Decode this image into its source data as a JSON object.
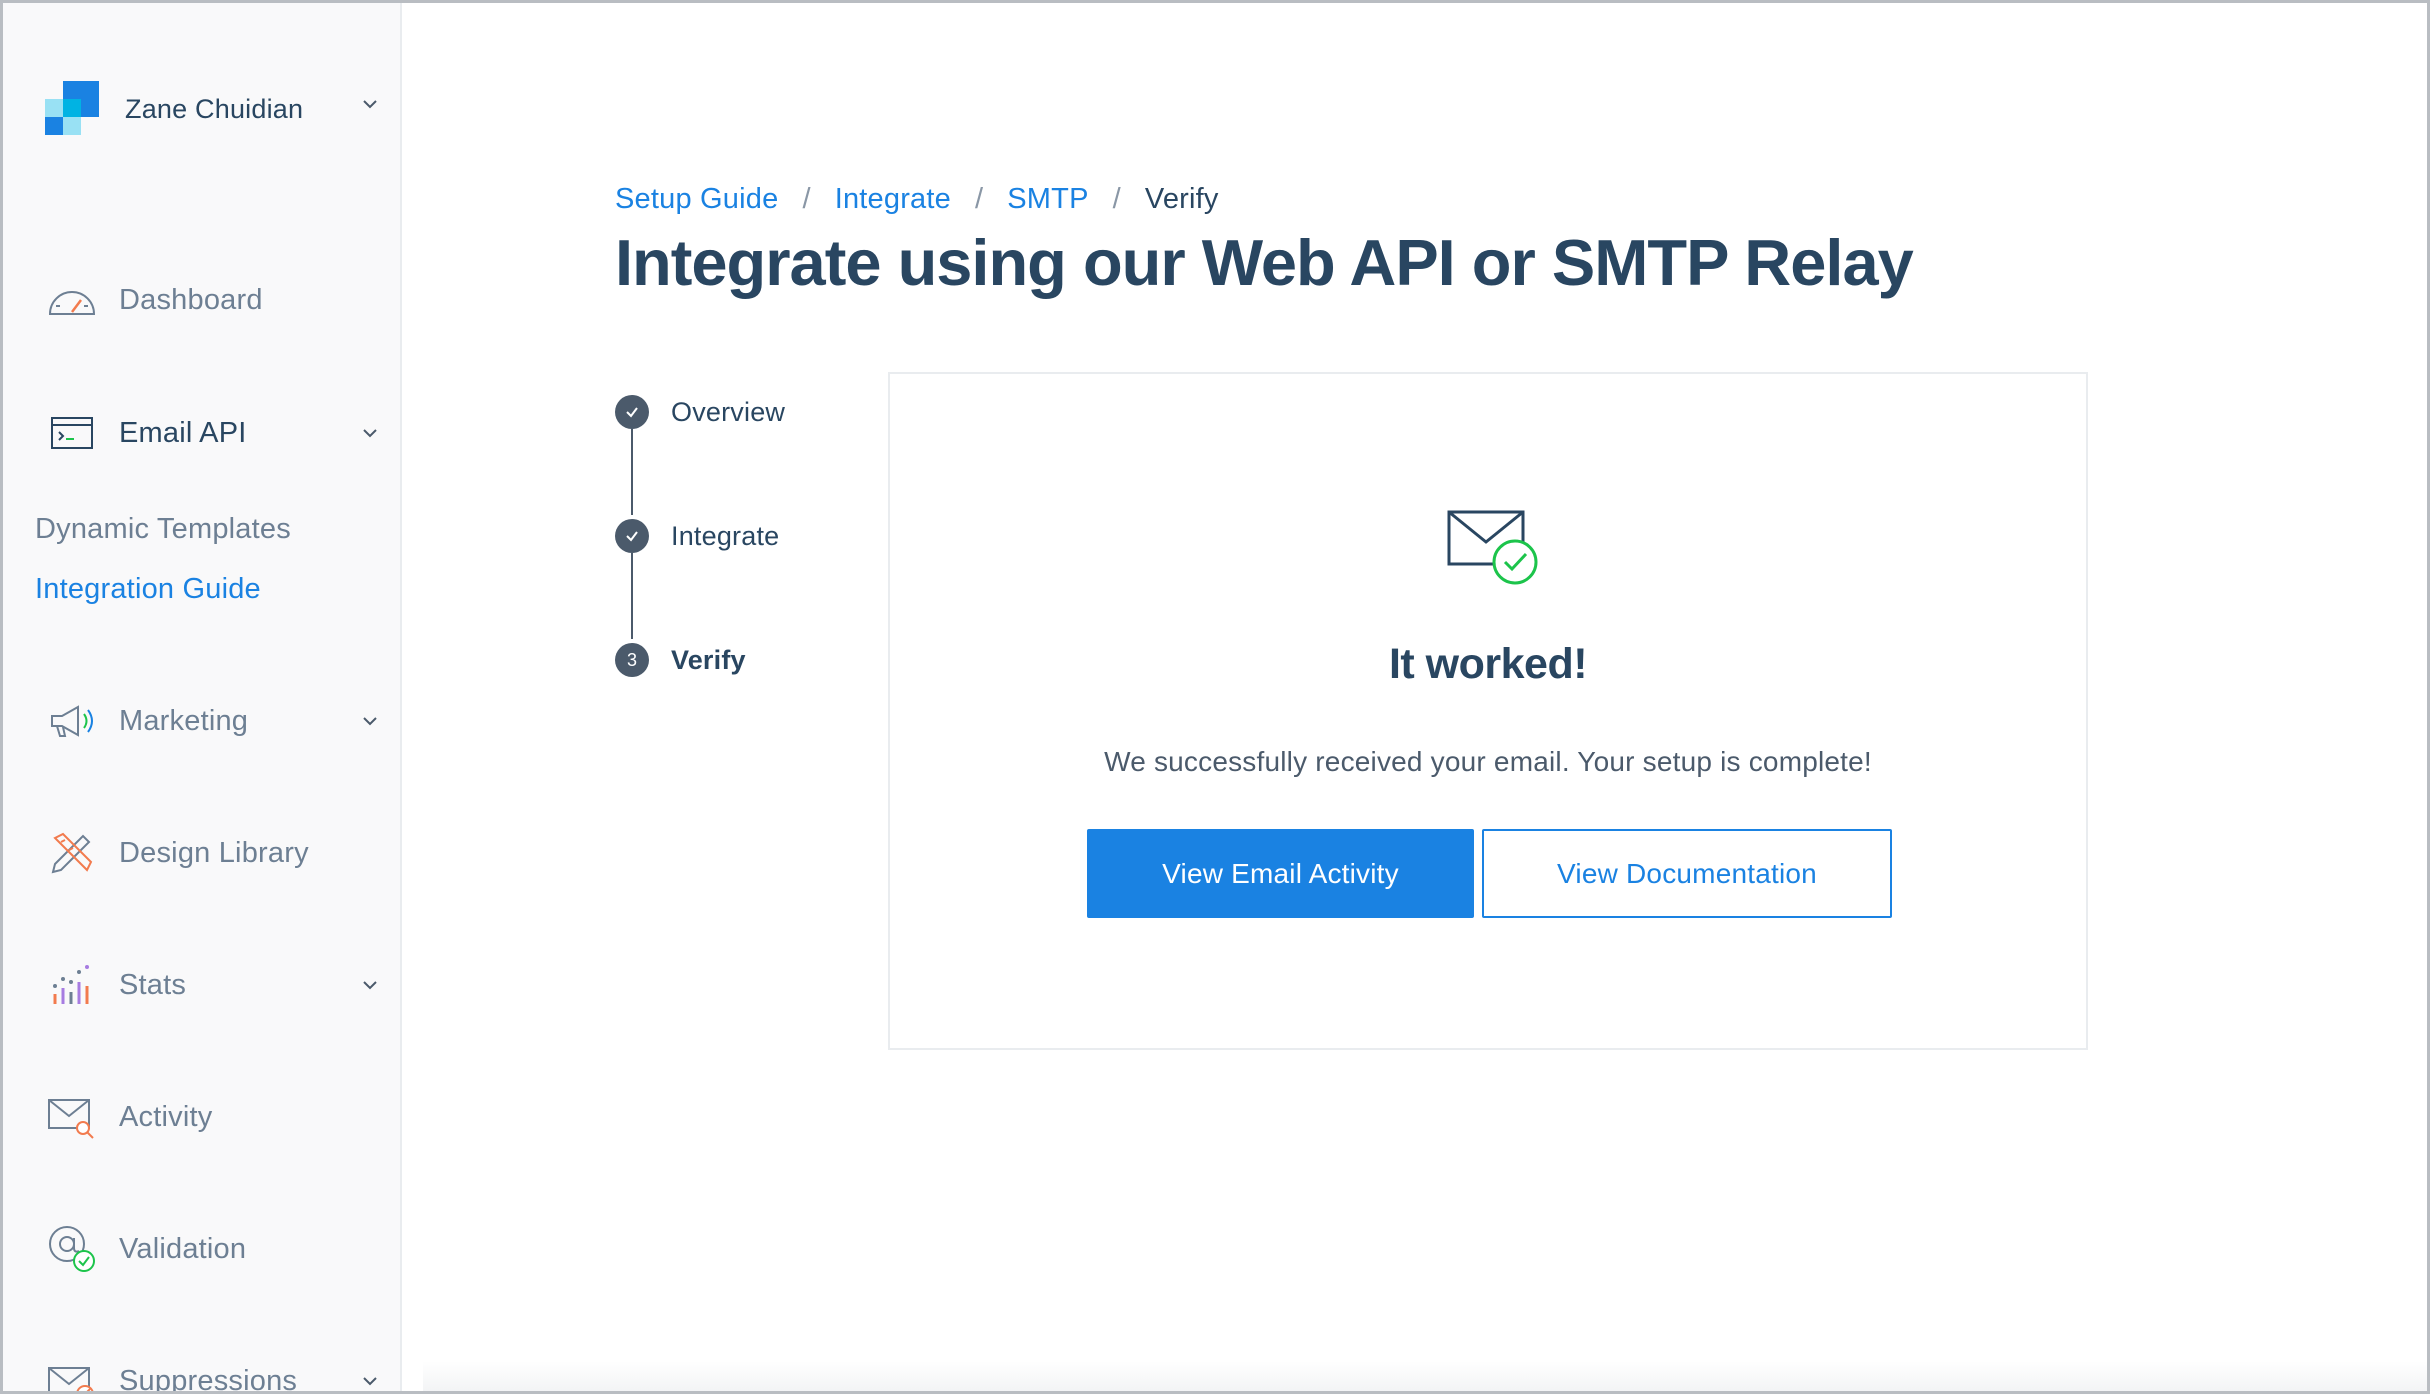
{
  "account": {
    "name": "Zane Chuidian"
  },
  "sidebar": {
    "items": [
      {
        "label": "Dashboard",
        "icon": "dashboard-gauge-icon"
      },
      {
        "label": "Email API",
        "icon": "terminal-window-icon"
      },
      {
        "label": "Marketing",
        "icon": "megaphone-icon"
      },
      {
        "label": "Design Library",
        "icon": "pencil-ruler-icon"
      },
      {
        "label": "Stats",
        "icon": "bar-chart-icon"
      },
      {
        "label": "Activity",
        "icon": "envelope-search-icon"
      },
      {
        "label": "Validation",
        "icon": "at-sign-check-icon"
      },
      {
        "label": "Suppressions",
        "icon": "envelope-block-icon"
      }
    ],
    "email_api_subitems": [
      "Dynamic Templates",
      "Integration Guide"
    ]
  },
  "breadcrumb": {
    "items": [
      "Setup Guide",
      "Integrate",
      "SMTP"
    ],
    "separator": "/",
    "current": "Verify"
  },
  "page_title": "Integrate using our Web API or SMTP Relay",
  "stepper": {
    "steps": [
      {
        "label": "Overview",
        "state": "complete"
      },
      {
        "label": "Integrate",
        "state": "complete"
      },
      {
        "label": "Verify",
        "state": "current",
        "number": "3"
      }
    ]
  },
  "card": {
    "icon": "envelope-check-icon",
    "heading": "It worked!",
    "message": "We successfully received your email. Your setup is complete!",
    "primary_button": "View Email Activity",
    "secondary_button": "View Documentation"
  },
  "colors": {
    "brand_blue": "#1a82e2",
    "navy_text": "#294661",
    "muted_text": "#6d7f93",
    "success_green": "#1cc44b"
  }
}
